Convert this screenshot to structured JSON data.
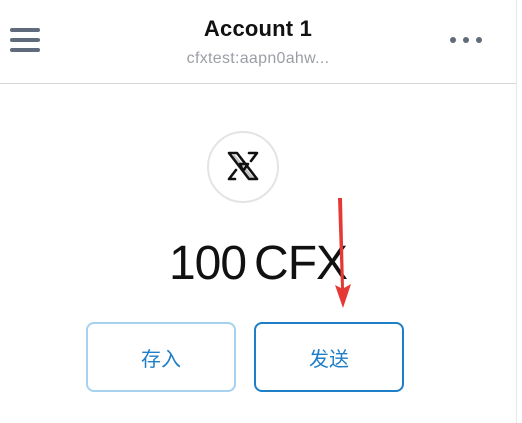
{
  "header": {
    "title": "Account 1",
    "address": "cfxtest:aapn0ahw...",
    "menu_icon": "hamburger-menu-icon",
    "more_icon": "more-dots-icon"
  },
  "token": {
    "logo_icon": "conflux-logo-icon",
    "amount": "100",
    "unit": "CFX"
  },
  "actions": {
    "deposit_label": "存入",
    "send_label": "发送"
  },
  "colors": {
    "accent": "#1e7ec7",
    "accent_light": "#a6d2ee",
    "annotation": "#e53935",
    "icon_gray": "#5f6b7a",
    "address_gray": "#9a9fa5"
  }
}
